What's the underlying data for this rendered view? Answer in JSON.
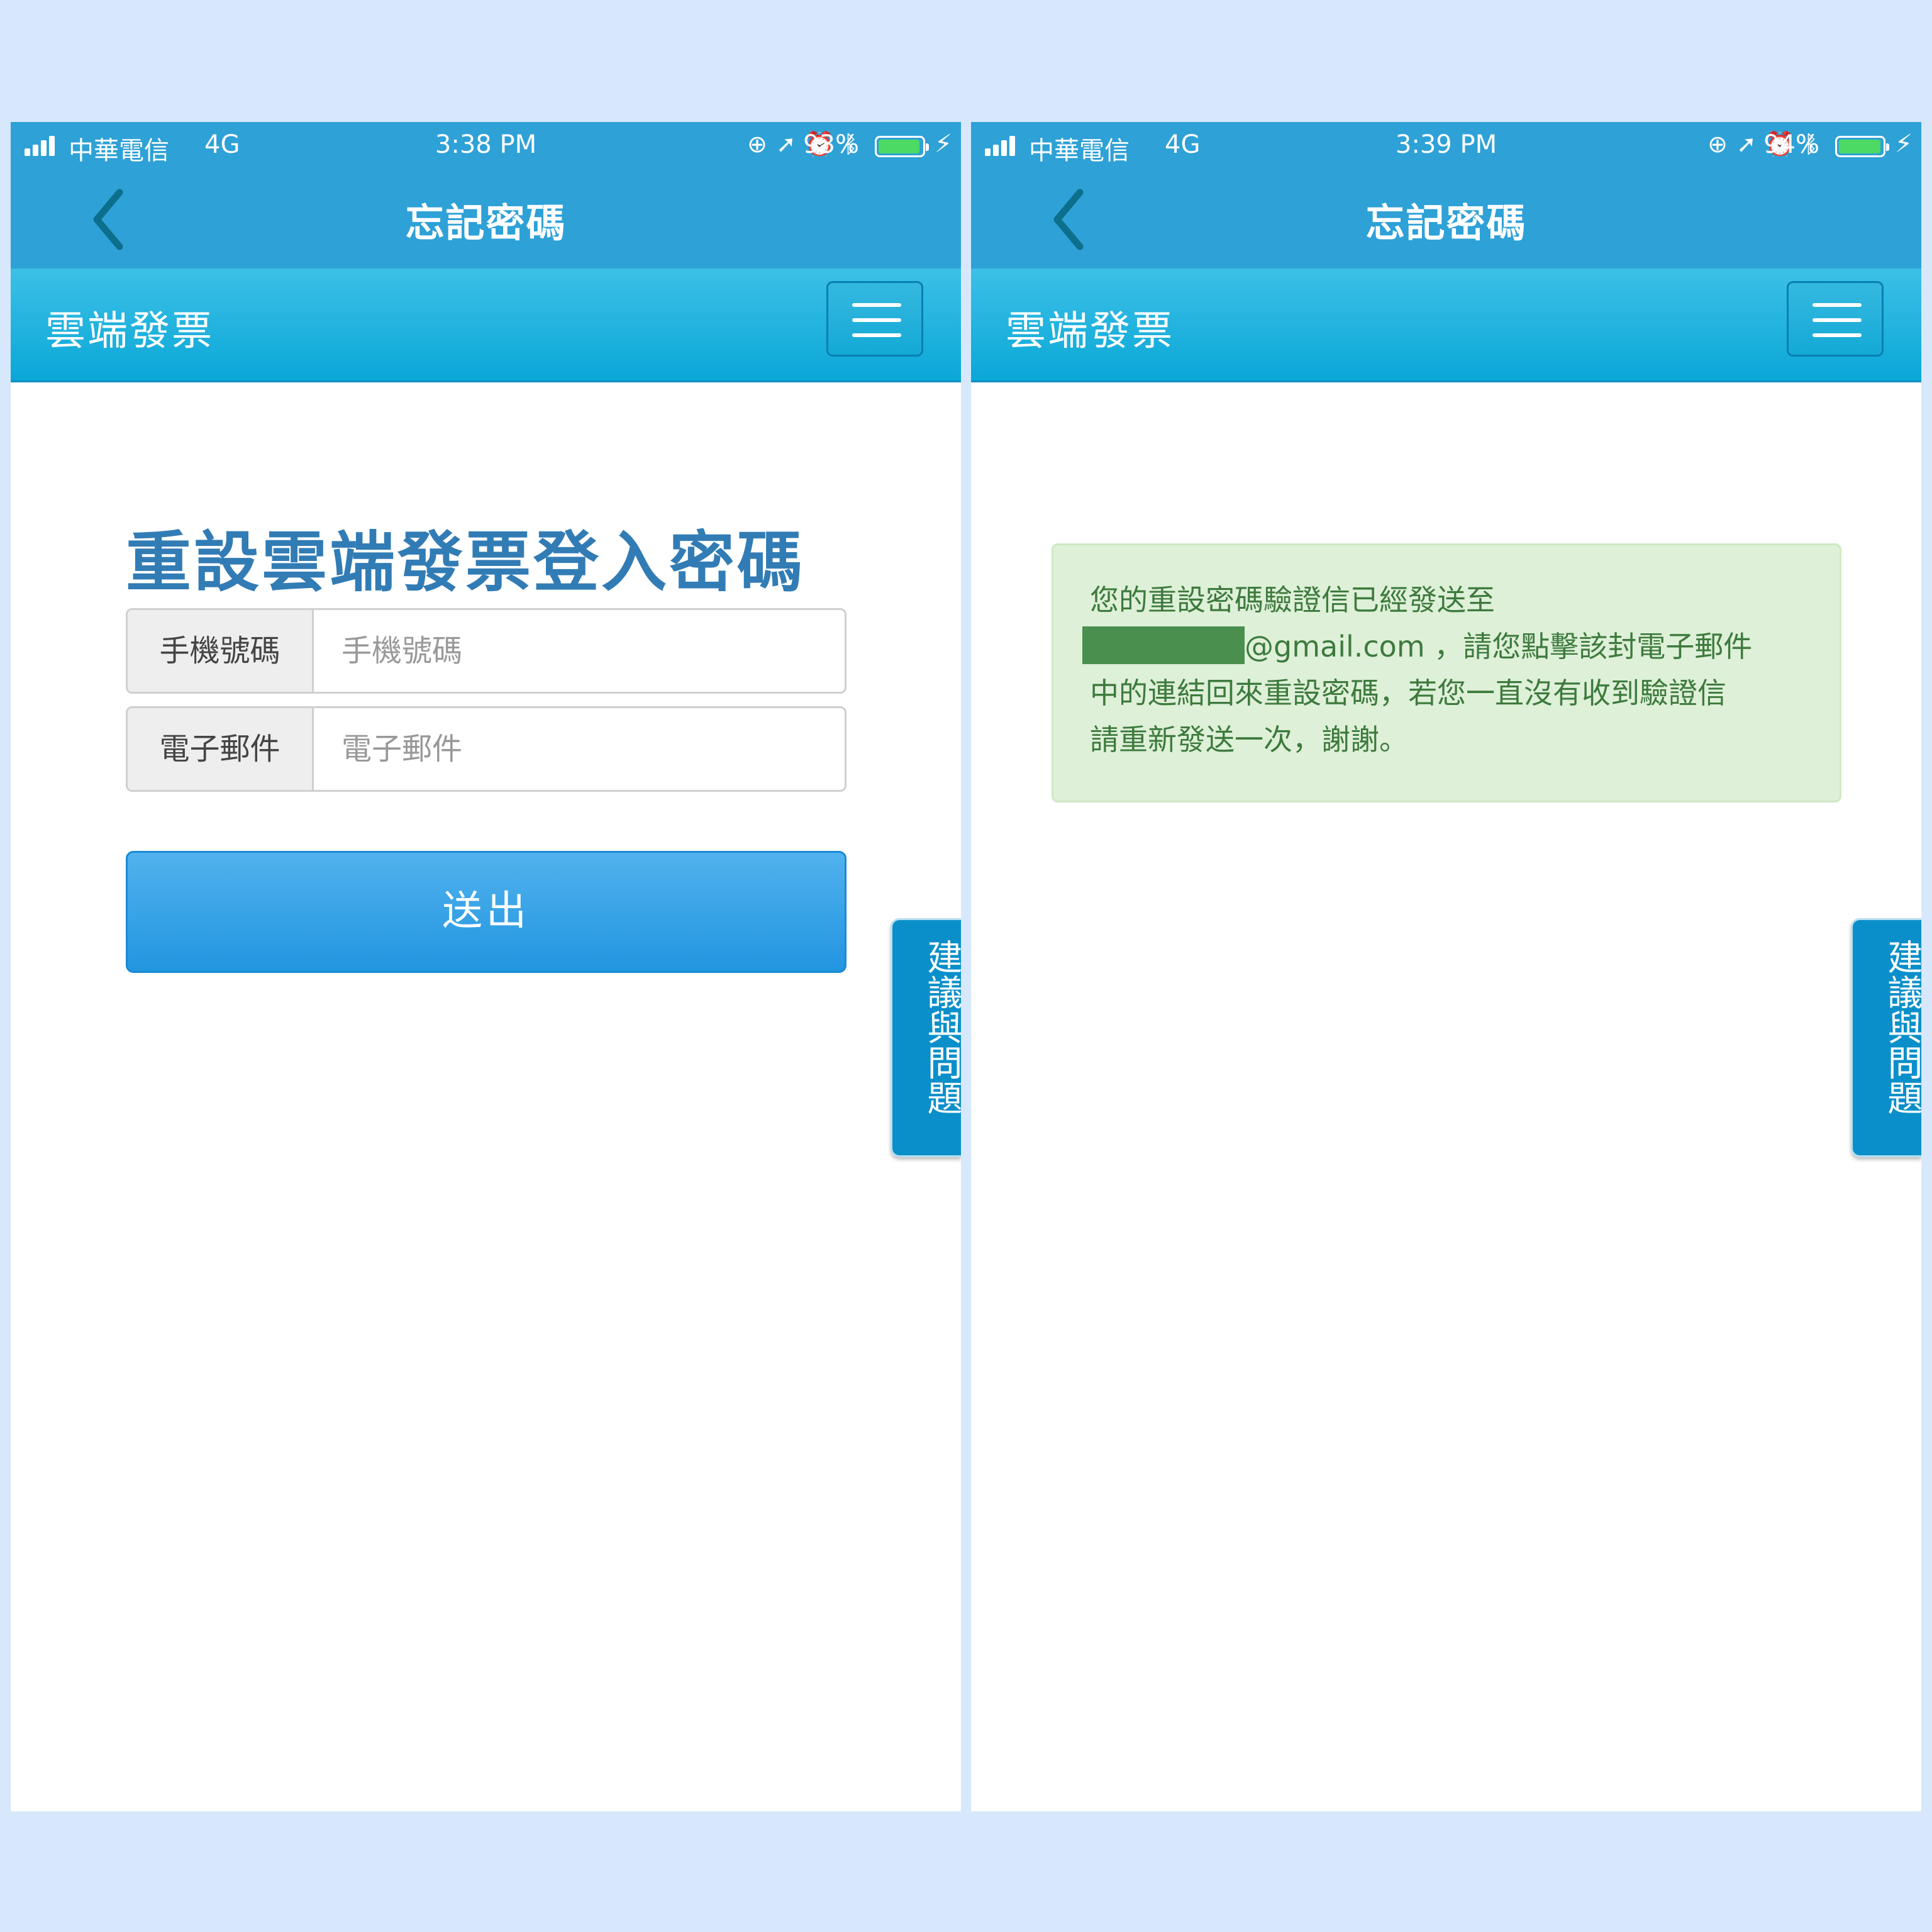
{
  "left_screen": {
    "status_bar": {
      "carrier": "中華電信",
      "network": "4G",
      "time": "3:38 PM",
      "battery_percent": "93%",
      "battery_level": 0.93
    },
    "header_title": "忘記密碼",
    "brand": "雲端發票",
    "page_heading": "重設雲端發票登入密碼",
    "phone_field": {
      "label": "手機號碼",
      "placeholder": "手機號碼",
      "value": ""
    },
    "email_field": {
      "label": "電子郵件",
      "placeholder": "電子郵件",
      "value": ""
    },
    "submit_label": "送出",
    "side_tab_label": "建議與問題"
  },
  "right_screen": {
    "status_bar": {
      "carrier": "中華電信",
      "network": "4G",
      "time": "3:39 PM",
      "battery_percent": "94%",
      "battery_level": 0.94
    },
    "header_title": "忘記密碼",
    "brand": "雲端發票",
    "alert": {
      "line1": "您的重設密碼驗證信已經發送至",
      "email_suffix": "@gmail.com",
      "line2_rest": "，請您點擊該封電子郵件",
      "line3": "中的連結回來重設密碼，若您一直沒有收到驗證信",
      "line4": "請重新發送一次，謝謝。"
    },
    "side_tab_label": "建議與問題"
  },
  "colors": {
    "page_background": "#d7e8fd",
    "header_blue": "#2ea1d7",
    "heading_blue": "#327cb5",
    "button_blue": "#2295e0",
    "alert_green_bg": "#def0d8",
    "alert_green_text": "#3d7a3d",
    "battery_green": "#4cd964"
  },
  "icons": {
    "signal": "signal-icon",
    "orientation_lock": "orientation-lock-icon",
    "location": "location-arrow-icon",
    "alarm": "alarm-icon",
    "bluetooth": "bluetooth-icon",
    "battery": "battery-icon",
    "charging": "charging-bolt-icon",
    "back": "chevron-left-icon",
    "menu": "hamburger-menu-icon"
  }
}
